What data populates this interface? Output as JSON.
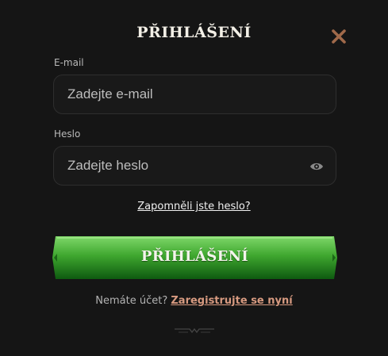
{
  "modal": {
    "title": "PŘIHLÁŠENÍ"
  },
  "email": {
    "label": "E-mail",
    "placeholder": "Zadejte e-mail",
    "value": ""
  },
  "password": {
    "label": "Heslo",
    "placeholder": "Zadejte heslo",
    "value": ""
  },
  "forgot_link": "Zapomněli jste heslo?",
  "login_button": "PŘIHLÁŠENÍ",
  "signup": {
    "prompt": "Nemáte účet?",
    "link": "Zaregistrujte se nyní"
  },
  "icons": {
    "close": "close-icon",
    "password_toggle": "eye-icon",
    "footer": "ornament-divider-icon"
  },
  "colors": {
    "background": "#151515",
    "close_icon": "#a0694a",
    "button_green_top": "#7fd86a",
    "button_green_bottom": "#0e5a10",
    "signup_link": "#d79a80"
  }
}
